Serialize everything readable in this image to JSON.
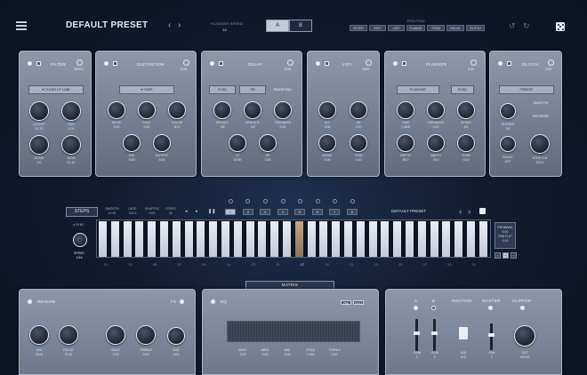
{
  "header": {
    "preset_name": "DEFAULT PRESET",
    "flanger_speed_label": "FLANGER SPEED",
    "flanger_speed_value": "1X",
    "ab": [
      "A",
      "B"
    ],
    "routing_label": "ROUTING",
    "routing_chips": [
      "FILTER",
      "DIST",
      "LOFI",
      "FLANGE",
      "TREM",
      "DELAY",
      "GLITCH"
    ]
  },
  "filter": {
    "title": "FILTER",
    "freq": "10000",
    "type": "CLEAN LP 12dB",
    "knobs": [
      {
        "label": "CUTOFF",
        "value": "20.7K"
      },
      {
        "label": "RES",
        "value": "0.00"
      },
      {
        "label": "DRIVE",
        "value": "0.0"
      },
      {
        "label": "HIGH",
        "value": "21.1K"
      }
    ]
  },
  "distortion": {
    "title": "DISTORTION",
    "amount": "0.00",
    "type": "TUBE",
    "knobs": [
      {
        "label": "DRIVE",
        "value": "0.00"
      },
      {
        "label": "FUZZ",
        "value": "0.00"
      },
      {
        "label": "COLOR",
        "value": "50.0"
      },
      {
        "label": "MIX",
        "value": "0.00"
      },
      {
        "label": "OUTPUT",
        "value": "0.00"
      }
    ]
  },
  "delay": {
    "title": "DELAY",
    "amount": "0.00",
    "buttons": [
      "SYNC",
      "FB",
      "PINGPONG"
    ],
    "knobs": [
      {
        "label": "SPEED L",
        "value": "1/8"
      },
      {
        "label": "SPEED R",
        "value": "1/8"
      },
      {
        "label": "FEEDBACK",
        "value": "0.00"
      },
      {
        "label": "LP",
        "value": "19.0K"
      },
      {
        "label": "HP",
        "value": "0.00"
      }
    ]
  },
  "lofi": {
    "title": "LOFI",
    "amount": "1000",
    "knobs": [
      {
        "label": "BIT",
        "value": "0.00"
      },
      {
        "label": "SR",
        "value": "0.00"
      },
      {
        "label": "NOISE",
        "value": "0.00"
      },
      {
        "label": "TONE",
        "value": "0.00"
      }
    ]
  },
  "flanger": {
    "title": "FLANGER",
    "amount": "0.00",
    "buttons": [
      "FLANGER",
      "SYNC"
    ],
    "knobs": [
      {
        "label": "TIME",
        "value": "1.0MS"
      },
      {
        "label": "FEEDBACK",
        "value": "0.00"
      },
      {
        "label": "SPEED",
        "value": "4/1"
      },
      {
        "label": "DEPTH",
        "value": "90.0"
      },
      {
        "label": "WIDTH",
        "value": "75.0"
      },
      {
        "label": "TONE",
        "value": "0.00"
      }
    ]
  },
  "glitch": {
    "title": "GLITCH",
    "amount": "0.00",
    "buttons": [
      "FREEZE",
      "SMOOTH",
      "REVERSE"
    ],
    "knobs": [
      {
        "label": "BUFFER",
        "value": "1/4"
      },
      {
        "label": "SCALE",
        "value": "OFF"
      },
      {
        "label": "STRETCH",
        "value": "100.0"
      }
    ]
  },
  "sequencer": {
    "steps_label": "STEPS",
    "params": [
      {
        "label": "SMOOTH",
        "value": "10.00"
      },
      {
        "label": "GATE",
        "value": "100.0"
      },
      {
        "label": "SHUFFLE",
        "value": "0.00"
      },
      {
        "label": "STEPS",
        "value": "32"
      }
    ],
    "pages": [
      "1",
      "2",
      "3",
      "4",
      "5",
      "6",
      "7",
      "8"
    ],
    "preset_name": "DEFAULT PRESET",
    "sync_label": "SYNC",
    "speed_label": "SPEED",
    "speed_value": "1/16",
    "step_numbers": [
      "01",
      "03",
      "05",
      "07",
      "09",
      "11",
      "13",
      "15",
      "17",
      "19",
      "21",
      "23",
      "25",
      "27",
      "29",
      "31"
    ],
    "probability_label": "PROBABIL",
    "probability_value": "0.00",
    "pan_flip_label": "PAN FLIP",
    "pan_flip_value": "0.00",
    "mini_buttons": [
      "<",
      "+",
      ">"
    ],
    "matrix_label": "MATRIX"
  },
  "reverb": {
    "title": "REVERB",
    "fx_label": "FX",
    "knobs": [
      {
        "label": "MIX",
        "value": "75.00"
      },
      {
        "label": "DECAY",
        "value": "75.00"
      },
      {
        "label": "BASS",
        "value": "0.00"
      },
      {
        "label": "TREBLE",
        "value": "0.00"
      },
      {
        "label": "SIZE",
        "value": "0.00"
      }
    ]
  },
  "eq": {
    "title": "EQ",
    "tags": [
      "PRE",
      "POST"
    ],
    "params": [
      {
        "label": "BASS",
        "value": "0.00"
      },
      {
        "label": "MIDS",
        "value": "0.00"
      },
      {
        "label": "MID",
        "value": "0.00"
      },
      {
        "label": "FREQ",
        "value": "1.00K"
      },
      {
        "label": "TREBLE",
        "value": "0.00"
      }
    ]
  },
  "master": {
    "ab": [
      "A",
      "B"
    ],
    "routing_label": "ROUTING",
    "master_label": "MASTER",
    "clipper_label": "CLIPPER",
    "faders": [
      {
        "label": "GAIN",
        "value": "C"
      },
      {
        "label": "GAIN",
        "value": "C"
      }
    ],
    "mix": {
      "label": "MIX",
      "value": "MIX"
    },
    "pan": {
      "label": "PAN",
      "value": "C"
    },
    "out": {
      "label": "OUT",
      "value": "100.00"
    }
  }
}
